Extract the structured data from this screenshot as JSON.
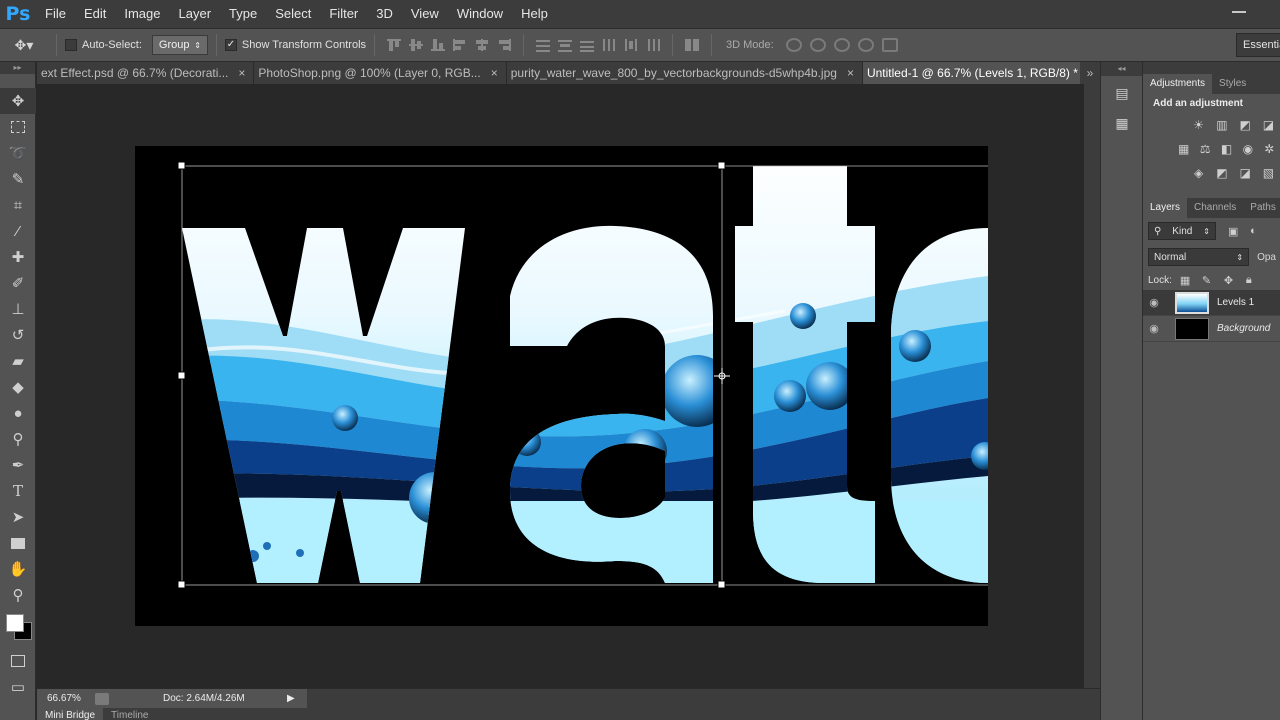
{
  "app": {
    "logo": "Ps"
  },
  "menu": [
    "File",
    "Edit",
    "Image",
    "Layer",
    "Type",
    "Select",
    "Filter",
    "3D",
    "View",
    "Window",
    "Help"
  ],
  "options": {
    "auto_select_label": "Auto-Select:",
    "auto_select_checked": false,
    "group_value": "Group",
    "show_transform_label": "Show Transform Controls",
    "show_transform_checked": true,
    "mode_3d_label": "3D Mode:",
    "workspace": "Essentials"
  },
  "tabs": [
    {
      "label": "ext Effect.psd @ 66.7% (Decorati...",
      "active": false
    },
    {
      "label": "PhotoShop.png @ 100% (Layer 0, RGB...",
      "active": false
    },
    {
      "label": "purity_water_wave_800_by_vectorbackgrounds-d5whp4b.jpg",
      "active": false
    },
    {
      "label": "Untitled-1 @ 66.7% (Levels 1, RGB/8) *",
      "active": true
    }
  ],
  "canvas": {
    "text": "water",
    "visible_text": "wate"
  },
  "status": {
    "zoom": "66.67%",
    "doc": "Doc: 2.64M/4.26M"
  },
  "bottom_tabs": [
    {
      "label": "Mini Bridge",
      "active": true
    },
    {
      "label": "Timeline",
      "active": false
    }
  ],
  "adjustments": {
    "tabs": [
      {
        "label": "Adjustments",
        "active": true
      },
      {
        "label": "Styles",
        "active": false
      }
    ],
    "heading": "Add an adjustment"
  },
  "layers": {
    "tabs": [
      {
        "label": "Layers",
        "active": true
      },
      {
        "label": "Channels",
        "active": false
      },
      {
        "label": "Paths",
        "active": false
      }
    ],
    "kind": "Kind",
    "blend_mode": "Normal",
    "opacity_label": "Opa",
    "lock_label": "Lock:",
    "items": [
      {
        "name": "Levels 1",
        "selected": true
      },
      {
        "name": "Background",
        "selected": false
      }
    ]
  },
  "colors": {
    "foreground": "#ffffff",
    "background": "#000000",
    "ui_dark": "#282828",
    "ui_panel": "#535353",
    "ps_blue": "#31a8ff"
  }
}
